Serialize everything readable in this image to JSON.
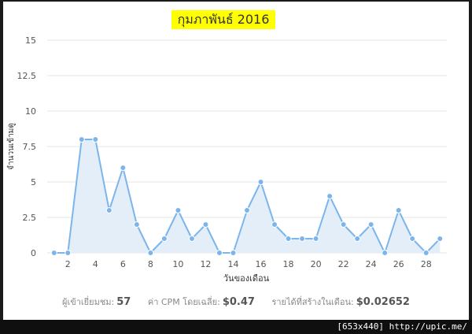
{
  "chart_data": {
    "type": "area",
    "title": "กุมภาพันธ์ 2016",
    "xlabel": "วันของเดือน",
    "ylabel": "จำนวนเข้ามดู",
    "x": [
      1,
      2,
      3,
      4,
      5,
      6,
      7,
      8,
      9,
      10,
      11,
      12,
      13,
      14,
      15,
      16,
      17,
      18,
      19,
      20,
      21,
      22,
      23,
      24,
      25,
      26,
      27,
      28,
      29
    ],
    "values": [
      0,
      0,
      8,
      8,
      3,
      6,
      2,
      0,
      1,
      3,
      1,
      2,
      0,
      0,
      3,
      5,
      2,
      1,
      1,
      1,
      4,
      2,
      1,
      2,
      0,
      3,
      1,
      0,
      1
    ],
    "xticks": [
      "2",
      "4",
      "6",
      "8",
      "10",
      "12",
      "14",
      "16",
      "18",
      "20",
      "22",
      "24",
      "26",
      "28"
    ],
    "yticks": [
      "0",
      "2.5",
      "5",
      "7.5",
      "10",
      "12.5",
      "15"
    ],
    "ylim": [
      0,
      15
    ],
    "xlim": [
      0.5,
      29.5
    ],
    "grid": true,
    "colors": {
      "line": "#7cb5ec",
      "fill": "#e3eef9",
      "grid": "#e6e6e6"
    }
  },
  "stats": {
    "visits_label": "ผู้เข้าเยี่ยมชม:",
    "visits_value": "57",
    "cpm_label": "ค่า CPM โดยเฉลี่ย:",
    "cpm_value": "$0.47",
    "revenue_label": "รายได้ที่สร้างในเดือน:",
    "revenue_value": "$0.02652"
  },
  "watermark": "[653x440] http://upic.me/"
}
